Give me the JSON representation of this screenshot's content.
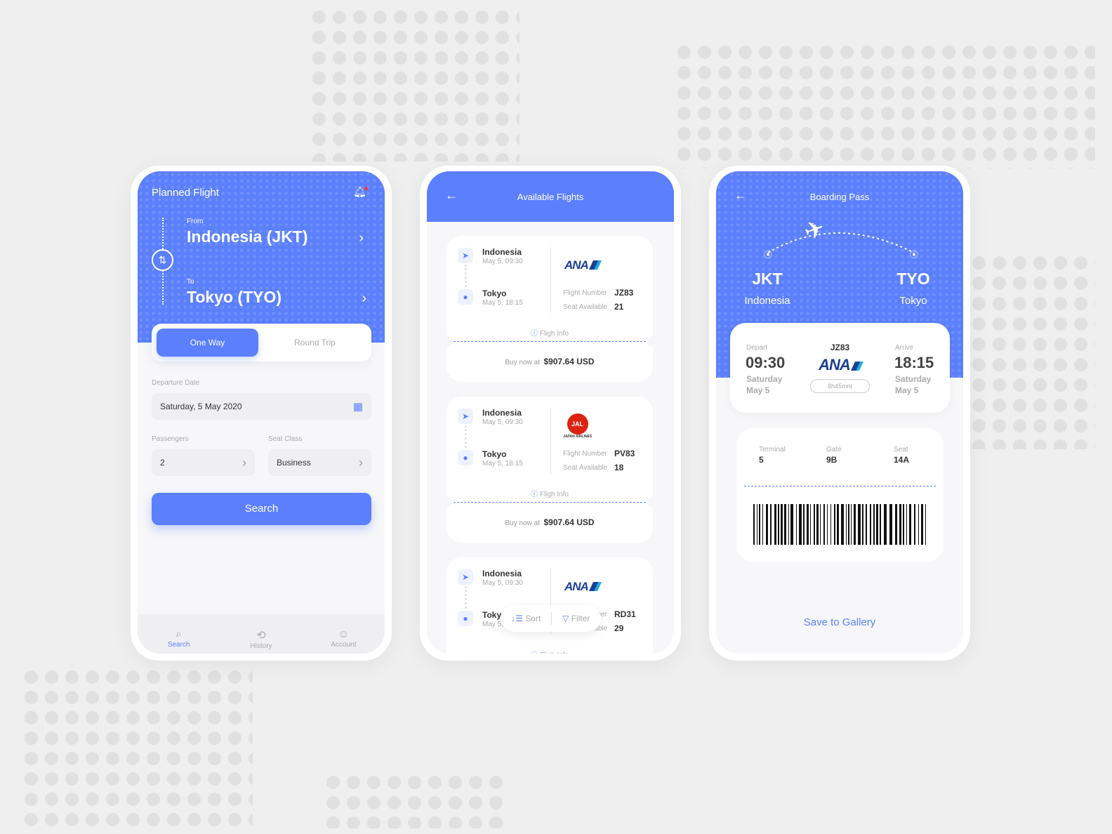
{
  "colors": {
    "accent": "#5b7ffd",
    "background": "#efefef"
  },
  "planned": {
    "title": "Planned Flight",
    "from_label": "From",
    "from_value": "Indonesia (JKT)",
    "to_label": "To",
    "to_value": "Tokyo (TYO)",
    "tabs": [
      "One Way",
      "Round Trip"
    ],
    "active_tab": "One Way",
    "departure_label": "Departure Date",
    "departure_value": "Saturday, 5 May 2020",
    "passengers_label": "Passengers",
    "passengers_value": "2",
    "seat_class_label": "Seat Class",
    "seat_class_value": "Business",
    "search_button": "Search",
    "nav": [
      {
        "label": "Search",
        "icon": "search-icon",
        "active": true
      },
      {
        "label": "History",
        "icon": "history-icon"
      },
      {
        "label": "Account",
        "icon": "account-icon"
      }
    ]
  },
  "available": {
    "title": "Available Flights",
    "flight_number_label": "Flight Number",
    "seat_available_label": "Seat Available",
    "info_label": "Fligh Info",
    "buy_label": "Buy now at",
    "flights": [
      {
        "from": "Indonesia",
        "from_time": "May 5, 09:30",
        "to": "Tokyo",
        "to_time": "May 5, 18:15",
        "airline": "ANA",
        "flight_number": "JZ83",
        "seats": "21",
        "price": "$907.64 USD"
      },
      {
        "from": "Indonesia",
        "from_time": "May 5, 09:30",
        "to": "Tokyo",
        "to_time": "May 5, 18:15",
        "airline": "JAL",
        "airline_sub": "JAPAN AIRLINES",
        "flight_number": "PV83",
        "seats": "18",
        "price": "$907.64 USD"
      },
      {
        "from": "Indonesia",
        "from_time": "May 5, 09:30",
        "to": "Tokyo",
        "to_time": "May 5, 18:15",
        "airline": "ANA",
        "flight_number": "RD31",
        "seats": "29"
      }
    ],
    "sort_label": "Sort",
    "filter_label": "Filter"
  },
  "boarding": {
    "title": "Boarding Pass",
    "from_code": "JKT",
    "from_city": "Indonesia",
    "to_code": "TYO",
    "to_city": "Tokyo",
    "depart_label": "Depart",
    "depart_time": "09:30",
    "depart_day": "Saturday",
    "depart_date": "May 5",
    "flight": "JZ83",
    "airline": "ANA",
    "duration": "8h45mnt",
    "arrive_label": "Arrive",
    "arrive_time": "18:15",
    "arrive_day": "Saturday",
    "arrive_date": "May 5",
    "terminal_label": "Terminal",
    "terminal": "5",
    "gate_label": "Gate",
    "gate": "9B",
    "seat_label": "Seat",
    "seat": "14A",
    "save_button": "Save to Gallery"
  }
}
